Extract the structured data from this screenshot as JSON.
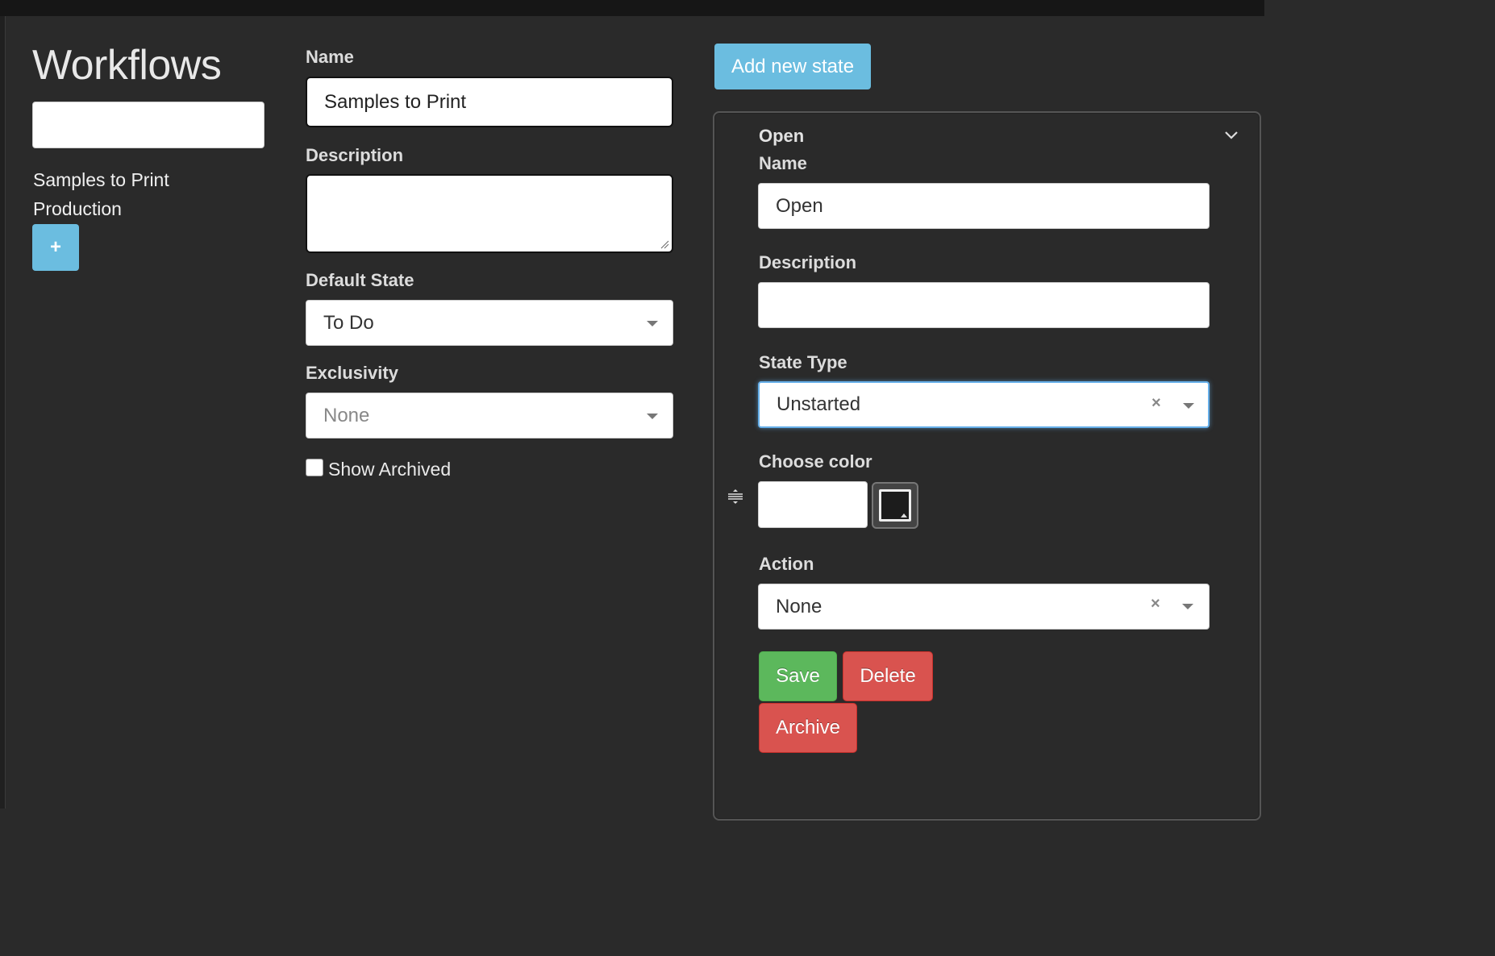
{
  "sidebar": {
    "title": "Workflows",
    "search_value": "",
    "workflows": [
      "Samples to Print",
      "Production"
    ],
    "add_label": "+"
  },
  "workflow_form": {
    "name_label": "Name",
    "name_value": "Samples to Print",
    "description_label": "Description",
    "description_value": "",
    "default_state_label": "Default State",
    "default_state_value": "To Do",
    "exclusivity_label": "Exclusivity",
    "exclusivity_value": "None",
    "show_archived_label": "Show Archived",
    "show_archived_checked": false
  },
  "state_panel": {
    "add_state_label": "Add new state",
    "header": "Open",
    "name_label": "Name",
    "name_value": "Open",
    "description_label": "Description",
    "description_value": "",
    "state_type_label": "State Type",
    "state_type_value": "Unstarted",
    "choose_color_label": "Choose color",
    "color_value": "",
    "action_label": "Action",
    "action_value": "None",
    "save_label": "Save",
    "delete_label": "Delete",
    "archive_label": "Archive",
    "clear_symbol": "×"
  },
  "colors": {
    "accent": "#6bbde0",
    "success": "#5cb85c",
    "danger": "#d9534f",
    "background": "#2a2a2a"
  },
  "icons": {
    "collapse": "chevron-down-icon",
    "drag": "drag-handle-icon",
    "dropdown": "caret-down-icon",
    "clear": "clear-icon"
  }
}
